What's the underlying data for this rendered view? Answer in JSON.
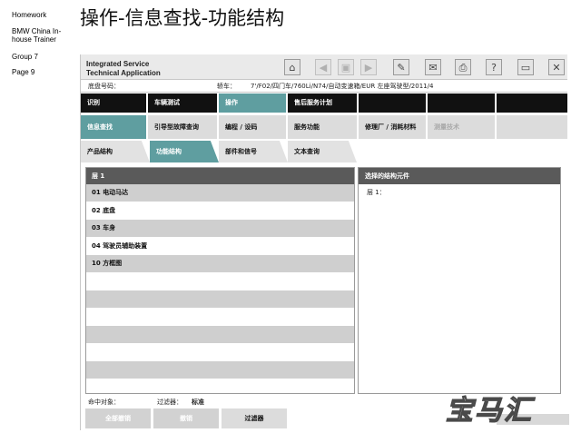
{
  "slide": {
    "homework": "Homework",
    "course": "BMW China In-house Trainer",
    "group": "Group 7",
    "page": "Page 9",
    "title": "操作-信息查找-功能结构"
  },
  "app": {
    "name_line1": "Integrated Service",
    "name_line2": "Technical Application",
    "toolbar": {
      "home_icon": "⌂",
      "back_icon": "◀",
      "history_icon": "▣",
      "forward_icon": "▶",
      "wrench_icon": "✎",
      "mail_icon": "✉",
      "print_icon": "⎙",
      "help_icon": "?",
      "minimize_icon": "▭",
      "close_icon": "✕"
    },
    "info": {
      "chassis_label": "底盘号码：",
      "vehicle_label": "轿车：",
      "vehicle_value": "7'/F02/四门车/760Li/N74/自动变速箱/EUR 左座驾驶型/2011/4"
    },
    "main_tabs": [
      "识别",
      "车辆测试",
      "操作",
      "售后服务计划"
    ],
    "sub_tabs": [
      {
        "label": "信息查找"
      },
      {
        "label": "引导型故障查询"
      },
      {
        "label": "编程 / 设码"
      },
      {
        "label": "服务功能"
      },
      {
        "label": "修理厂 / 消耗材料"
      },
      {
        "label": "测量技术"
      }
    ],
    "third_tabs": [
      "产品结构",
      "功能结构",
      "部件和信号",
      "文本查询"
    ],
    "left_panel": {
      "header": "层 1",
      "rows": [
        "01 电动马达",
        "02 底盘",
        "03 车身",
        "04 驾驶员辅助装置",
        "10 方框图"
      ]
    },
    "right_panel": {
      "header": "选择的结构元件",
      "level": "层 1："
    },
    "footer": {
      "hits_label": "命中对象：",
      "filter_label": "过滤器：",
      "filter_value": "标准",
      "buttons": [
        "全部撤销",
        "撤销",
        "过滤器"
      ]
    }
  },
  "watermark": {
    "text": "宝马汇"
  }
}
